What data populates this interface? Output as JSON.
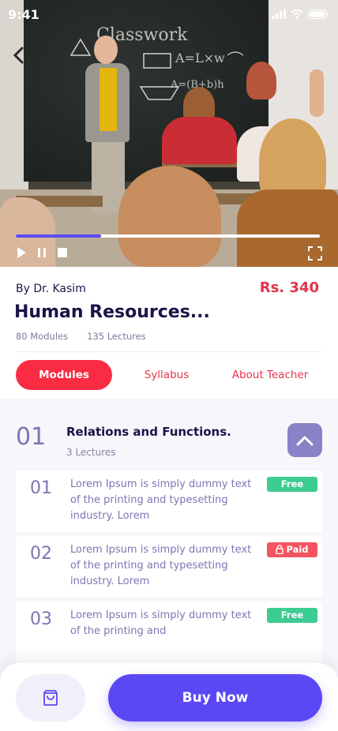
{
  "status_bar": {
    "time": "9:41"
  },
  "video": {
    "progress": 0.28,
    "chalk_words": {
      "title": "Classwork",
      "eq1": "A=L×w",
      "eq2": "A=(B+b)h"
    }
  },
  "course": {
    "author": "By Dr. Kasim",
    "price": "Rs. 340",
    "title": "Human Resources...",
    "modules_count": "80 Modules",
    "lectures_count": "135 Lectures"
  },
  "tabs": [
    {
      "label": "Modules",
      "active": true
    },
    {
      "label": "Syllabus",
      "active": false
    },
    {
      "label": "About Teacher",
      "active": false
    }
  ],
  "module": {
    "number": "01",
    "title": "Relations and Functions.",
    "lectures": "3 Lectures"
  },
  "lectures": [
    {
      "number": "01",
      "text": "Lorem Ipsum is simply dummy text of the printing and typesetting industry. Lorem",
      "badge": "Free"
    },
    {
      "number": "02",
      "text": "Lorem Ipsum is simply dummy text of the printing and typesetting industry. Lorem",
      "badge": "Paid"
    },
    {
      "number": "03",
      "text": "Lorem Ipsum is simply dummy text of the printing and",
      "badge": "Free"
    }
  ],
  "actions": {
    "buy_label": "Buy Now"
  },
  "icons": {
    "back": "chevron-left-icon",
    "play": "play-icon",
    "pause": "pause-icon",
    "stop": "stop-icon",
    "fullscreen": "fullscreen-icon",
    "collapse": "chevron-up-icon",
    "cart": "shopping-bag-icon",
    "lock": "lock-icon"
  },
  "colors": {
    "primary": "#5a48f5",
    "accent_red": "#fa2c43",
    "price": "#e4334a",
    "free": "#3dcc92",
    "paid": "#f3545f",
    "muted_purple": "#7f74b3"
  }
}
